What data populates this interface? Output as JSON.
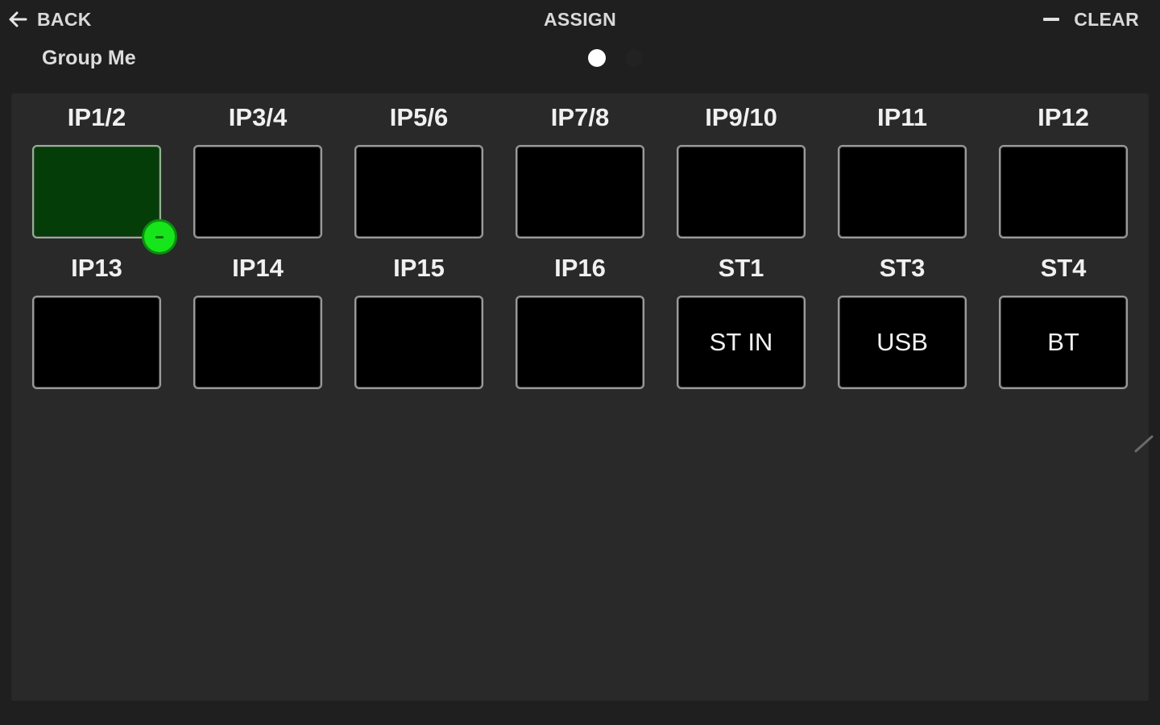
{
  "header": {
    "back_label": "BACK",
    "title": "ASSIGN",
    "clear_label": "CLEAR",
    "group_name": "Group Me"
  },
  "pagination": {
    "total_pages": 2,
    "current_page": 1
  },
  "channels": [
    {
      "label": "IP1/2",
      "text": "",
      "assigned": true
    },
    {
      "label": "IP3/4",
      "text": "",
      "assigned": false
    },
    {
      "label": "IP5/6",
      "text": "",
      "assigned": false
    },
    {
      "label": "IP7/8",
      "text": "",
      "assigned": false
    },
    {
      "label": "IP9/10",
      "text": "",
      "assigned": false
    },
    {
      "label": "IP11",
      "text": "",
      "assigned": false
    },
    {
      "label": "IP12",
      "text": "",
      "assigned": false
    },
    {
      "label": "IP13",
      "text": "",
      "assigned": false
    },
    {
      "label": "IP14",
      "text": "",
      "assigned": false
    },
    {
      "label": "IP15",
      "text": "",
      "assigned": false
    },
    {
      "label": "IP16",
      "text": "",
      "assigned": false
    },
    {
      "label": "ST1",
      "text": "ST IN",
      "assigned": false
    },
    {
      "label": "ST3",
      "text": "USB",
      "assigned": false
    },
    {
      "label": "ST4",
      "text": "BT",
      "assigned": false
    }
  ],
  "icons": {
    "back": "arrow-left-icon",
    "clear": "minus-icon",
    "assigned_badge": "remove-icon"
  },
  "colors": {
    "assigned_fill": "#053d08",
    "badge": "#15e51a"
  }
}
